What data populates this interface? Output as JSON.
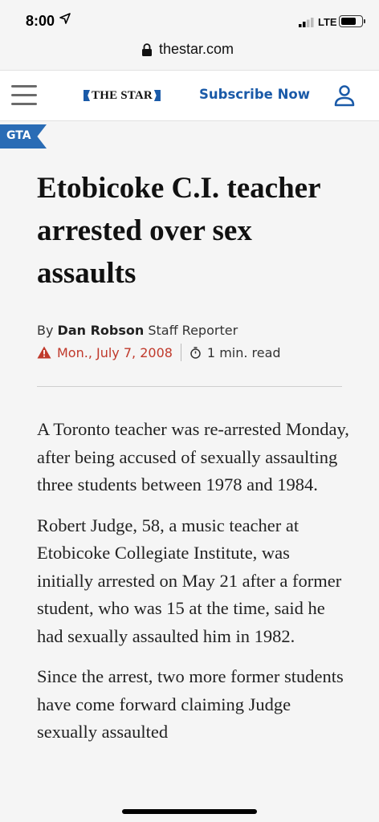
{
  "status_bar": {
    "time": "8:00",
    "network": "LTE",
    "battery_level": 0.75
  },
  "browser": {
    "domain": "thestar.com"
  },
  "site_header": {
    "logo_text": "THE STAR",
    "subscribe_label": "Subscribe Now"
  },
  "section": {
    "tag": "GTA"
  },
  "article": {
    "headline": "Etobicoke C.I. teacher arrested over sex assaults",
    "byline_prefix": "By ",
    "author": "Dan Robson",
    "author_role": " Staff Reporter",
    "date": "Mon., July 7, 2008",
    "read_time": "1 min. read",
    "paragraphs": [
      "A Toronto teacher was re-arrested Monday, after being accused of sexually assaulting three students between 1978 and 1984.",
      "Robert Judge, 58, a music teacher at Etobicoke Collegiate Institute, was initially arrested on May 21 after a former student, who was 15 at the time, said he had sexually assaulted him in 1982.",
      "Since the arrest, two more former students have come forward claiming Judge sexually assaulted"
    ]
  },
  "icons": {
    "location": "location-arrow-icon",
    "signal": "signal-bars-icon",
    "battery": "battery-icon",
    "lock": "lock-icon",
    "menu": "hamburger-menu-icon",
    "user": "user-account-icon",
    "warning": "warning-triangle-icon",
    "clock": "stopwatch-icon"
  },
  "colors": {
    "brand_blue": "#1a5aa8",
    "tag_blue": "#2a6cb5",
    "date_red": "#c0392b"
  }
}
